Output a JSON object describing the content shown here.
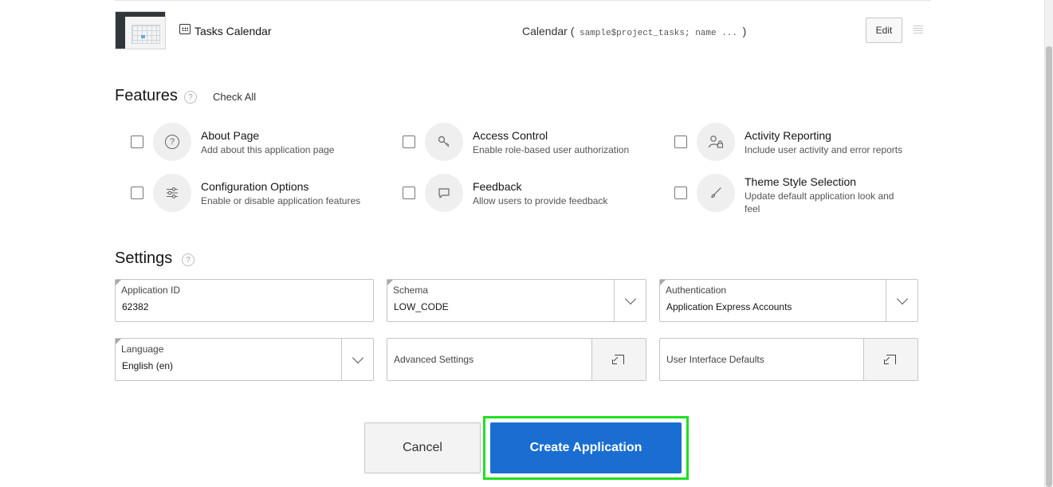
{
  "page_row": {
    "name": "Tasks Calendar",
    "source_prefix": "Calendar (",
    "source_mono": " sample$project_tasks; name ... ",
    "source_suffix": ")",
    "edit_label": "Edit"
  },
  "features": {
    "title": "Features",
    "help": "?",
    "check_all": "Check All",
    "items": [
      {
        "title": "About Page",
        "desc": "Add about this application page",
        "icon": "question-icon",
        "glyph": "?"
      },
      {
        "title": "Access Control",
        "desc": "Enable role-based user authorization",
        "icon": "key-icon",
        "glyph": "⚿"
      },
      {
        "title": "Activity Reporting",
        "desc": "Include user activity and error reports",
        "icon": "user-lock-icon",
        "glyph": "👤"
      },
      {
        "title": "Configuration Options",
        "desc": "Enable or disable application features",
        "icon": "sliders-icon",
        "glyph": "⚌"
      },
      {
        "title": "Feedback",
        "desc": "Allow users to provide feedback",
        "icon": "comment-icon",
        "glyph": "💬"
      },
      {
        "title": "Theme Style Selection",
        "desc": "Update default application look and feel",
        "icon": "brush-icon",
        "glyph": "✎"
      }
    ]
  },
  "settings": {
    "title": "Settings",
    "help": "?",
    "application_id": {
      "label": "Application ID",
      "value": "62382"
    },
    "schema": {
      "label": "Schema",
      "value": "LOW_CODE"
    },
    "authentication": {
      "label": "Authentication",
      "value": "Application Express Accounts"
    },
    "language": {
      "label": "Language",
      "value": "English (en)"
    },
    "advanced": {
      "label": "Advanced Settings"
    },
    "ui_defaults": {
      "label": "User Interface Defaults"
    }
  },
  "actions": {
    "cancel": "Cancel",
    "create": "Create Application"
  },
  "colors": {
    "primary": "#1a6ed1",
    "highlight_outline": "#1ee01e"
  }
}
